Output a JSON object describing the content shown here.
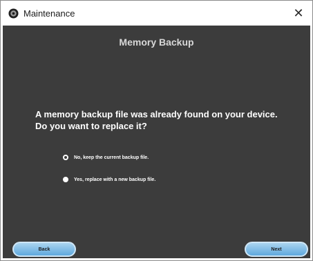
{
  "window": {
    "title": "Maintenance",
    "icon": "app-logo-icon",
    "close_icon": "close-icon",
    "close_glyph": "✕"
  },
  "dialog": {
    "heading": "Memory Backup",
    "question": "A memory backup file was already found on your device. Do you want to replace it?",
    "options": [
      {
        "label": "No, keep the current backup file.",
        "selected": true
      },
      {
        "label": "Yes, replace with a new backup file.",
        "selected": false
      }
    ]
  },
  "buttons": {
    "back_label": "Back",
    "next_label": "Next"
  },
  "colors": {
    "panel_background": "#3c3c3c",
    "button_gradient_top": "#aad4f0",
    "button_gradient_bottom": "#5fa8dd"
  }
}
